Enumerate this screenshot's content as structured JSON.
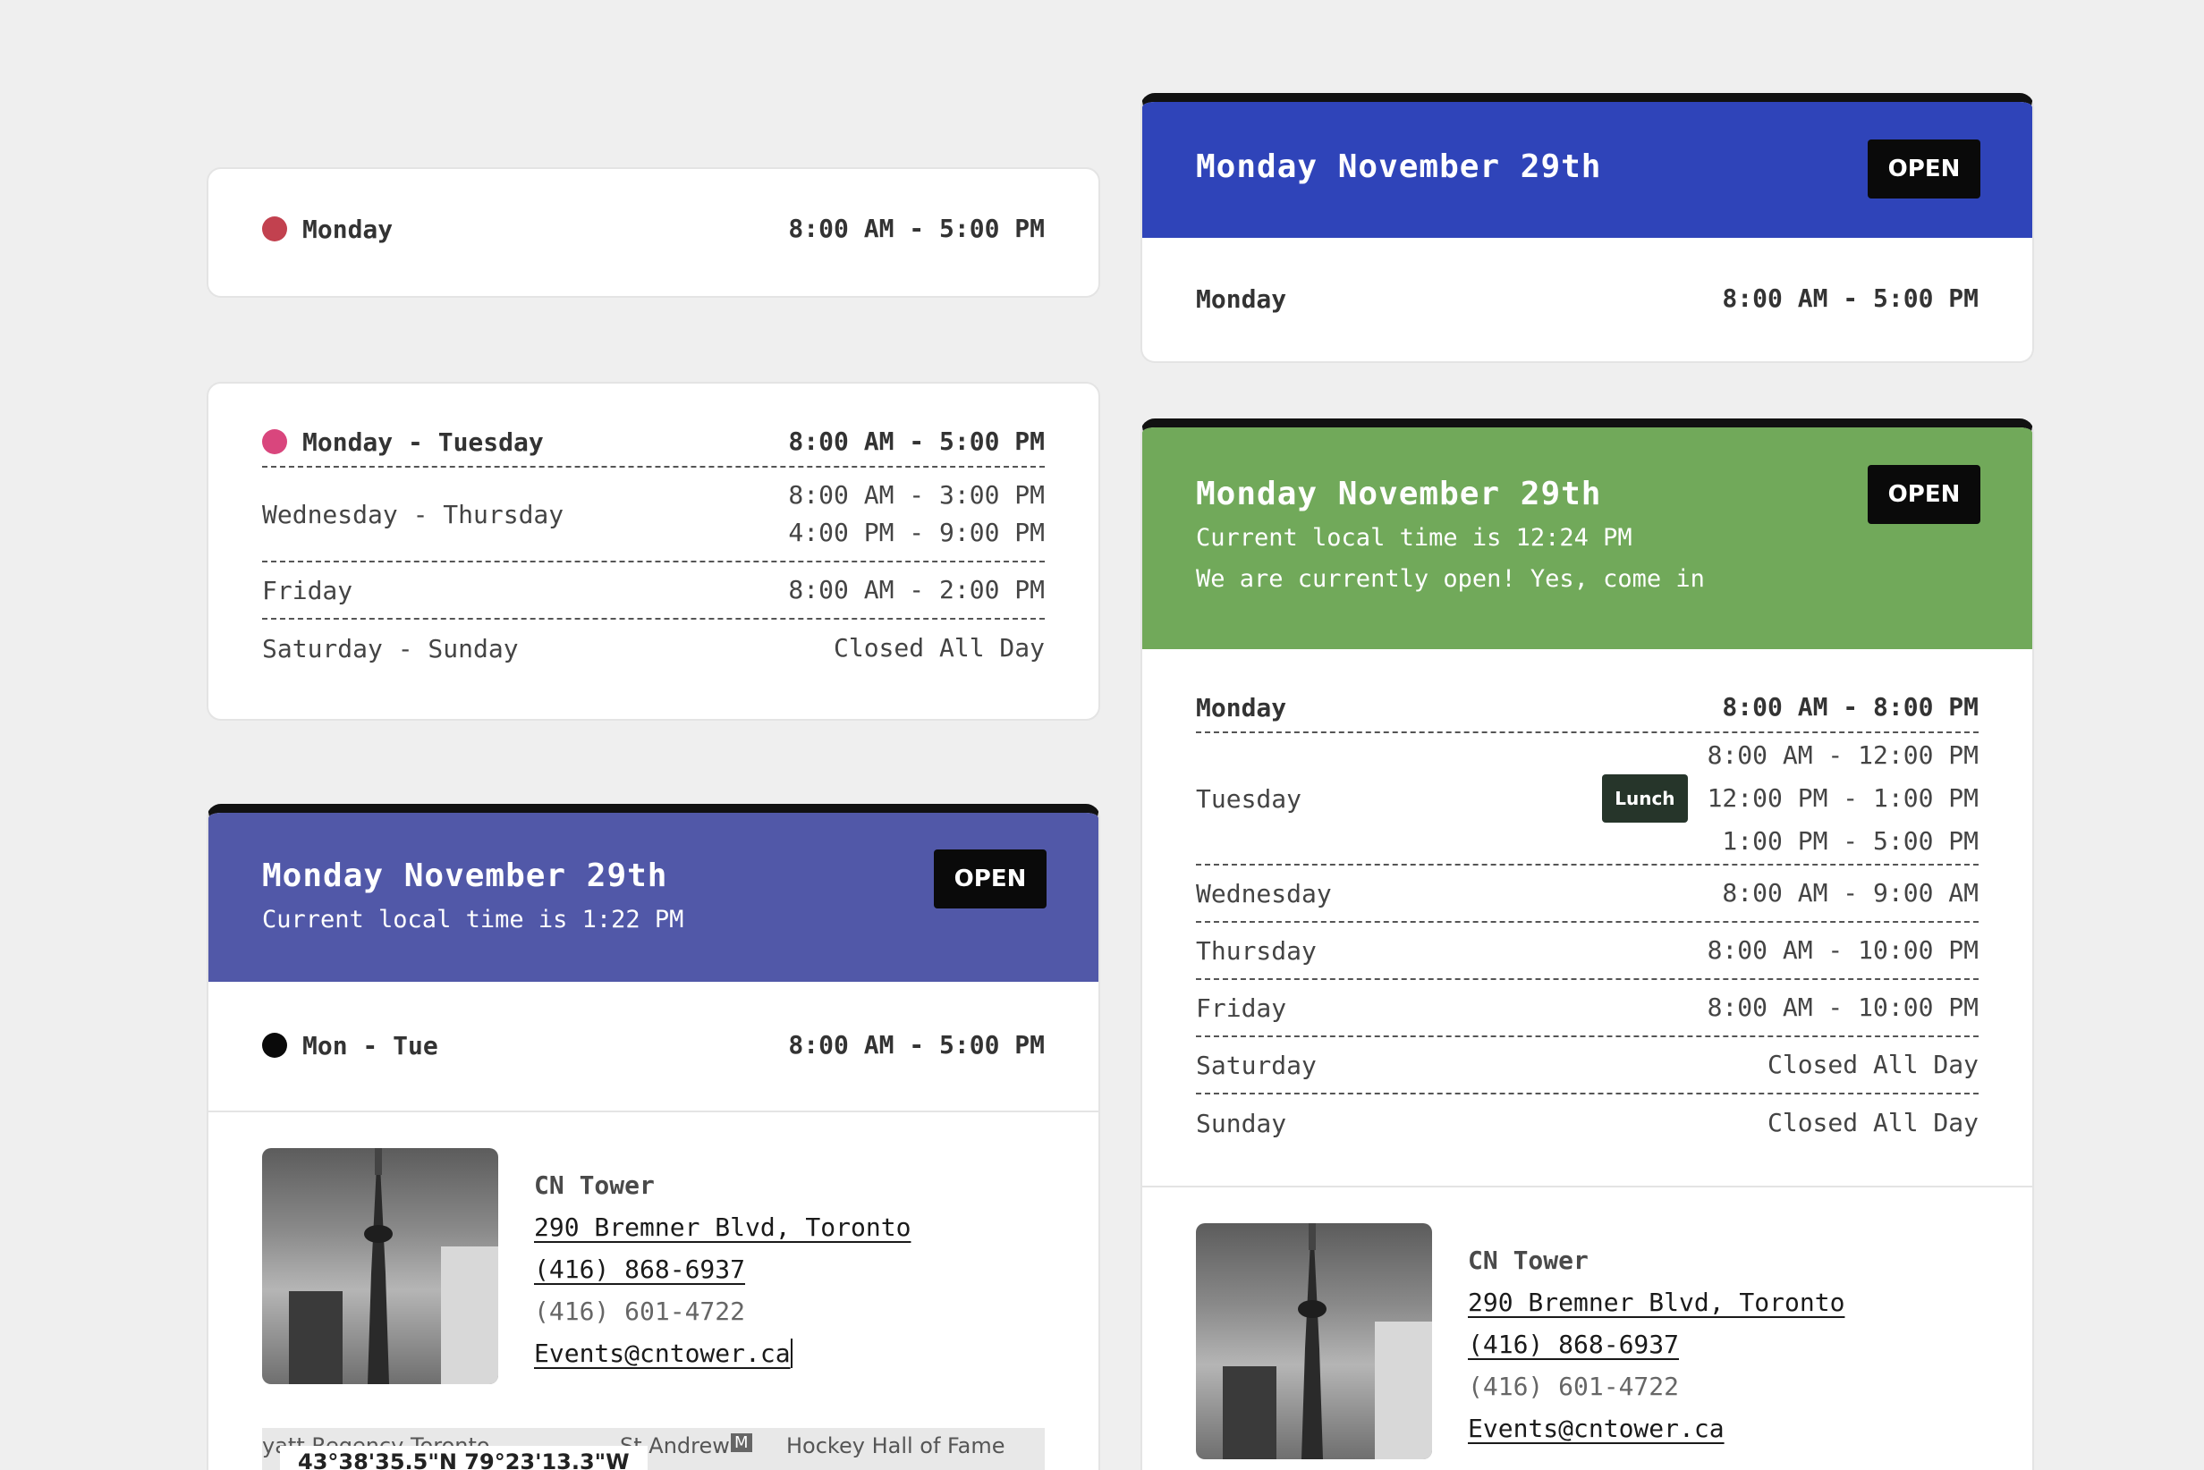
{
  "colors": {
    "page_bg": "#efefef",
    "dot_red": "#c2414f",
    "dot_pink": "#d9467d",
    "dot_black": "#0a0a0a",
    "header_blue": "#2f44b9",
    "header_indigo": "#5158a8",
    "header_green": "#71a95a",
    "badge_black": "#0a0a0a",
    "lunch_badge": "#26352a"
  },
  "card1": {
    "rows": [
      {
        "day": "Monday",
        "hours": "8:00 AM - 5:00 PM"
      }
    ]
  },
  "card2": {
    "rows": [
      {
        "day": "Monday - Tuesday",
        "hours": [
          "8:00 AM - 5:00 PM"
        ]
      },
      {
        "day": "Wednesday - Thursday",
        "hours": [
          "8:00 AM - 3:00 PM",
          "4:00 PM - 9:00 PM"
        ]
      },
      {
        "day": "Friday",
        "hours": [
          "8:00 AM - 2:00 PM"
        ]
      },
      {
        "day": "Saturday - Sunday",
        "hours": [
          "Closed All Day"
        ]
      }
    ]
  },
  "card3": {
    "title": "Monday November 29th",
    "subtitle": "Current local time is 1:22 PM",
    "badge": "OPEN",
    "rows": [
      {
        "day": "Mon - Tue",
        "hours": "8:00 AM - 5:00 PM"
      }
    ],
    "contact": {
      "name": "CN Tower",
      "address": "290 Bremner Blvd, Toronto",
      "phone1": "(416) 868-6937",
      "phone2": "(416) 601-4722",
      "email": "Events@cntower.ca"
    },
    "map": {
      "labels": [
        "yatt Regency Toronto",
        "St Andrew",
        "Hockey Hall of Fame"
      ],
      "metro_icon": "M",
      "coords": "43°38'35.5\"N 79°23'13.3\"W"
    }
  },
  "card4": {
    "title": "Monday November 29th",
    "badge": "OPEN",
    "rows": [
      {
        "day": "Monday",
        "hours": "8:00 AM - 5:00 PM"
      }
    ]
  },
  "card5": {
    "title": "Monday November 29th",
    "subtitle1": "Current local time is 12:24 PM",
    "subtitle2": "We are currently open! Yes, come in",
    "badge": "OPEN",
    "lunch_label": "Lunch",
    "rows": [
      {
        "day": "Monday",
        "hours": [
          "8:00 AM - 8:00 PM"
        ]
      },
      {
        "day": "Tuesday",
        "hours": [
          "8:00 AM - 12:00 PM",
          "12:00 PM - 1:00 PM",
          "1:00 PM - 5:00 PM"
        ]
      },
      {
        "day": "Wednesday",
        "hours": [
          "8:00 AM - 9:00 AM"
        ]
      },
      {
        "day": "Thursday",
        "hours": [
          "8:00 AM - 10:00 PM"
        ]
      },
      {
        "day": "Friday",
        "hours": [
          "8:00 AM - 10:00 PM"
        ]
      },
      {
        "day": "Saturday",
        "hours": [
          "Closed All Day"
        ]
      },
      {
        "day": "Sunday",
        "hours": [
          "Closed All Day"
        ]
      }
    ],
    "contact": {
      "name": "CN Tower",
      "address": "290 Bremner Blvd, Toronto",
      "phone1": "(416) 868-6937",
      "phone2": "(416) 601-4722",
      "email": "Events@cntower.ca"
    }
  }
}
